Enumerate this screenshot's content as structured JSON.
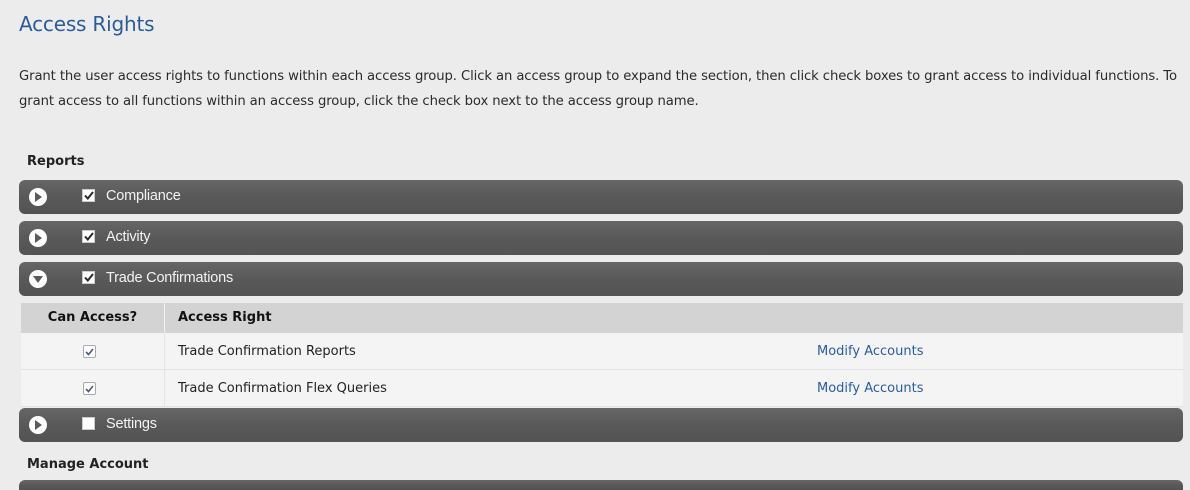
{
  "title": "Access Rights",
  "description": "Grant the user access rights to functions within each access group. Click an access group to expand the section, then click check boxes to grant access to individual functions. To grant access to all functions within an access group, click the check box next to the access group name.",
  "sections": {
    "reports_label": "Reports",
    "manage_account_label": "Manage Account"
  },
  "groups": [
    {
      "label": "Compliance",
      "checked": true,
      "expanded": false
    },
    {
      "label": "Activity",
      "checked": true,
      "expanded": false
    },
    {
      "label": "Trade Confirmations",
      "checked": true,
      "expanded": true
    },
    {
      "label": "Settings",
      "checked": false,
      "expanded": false
    }
  ],
  "table": {
    "col_can_access": "Can Access?",
    "col_access_right": "Access Right",
    "rows": [
      {
        "right": "Trade Confirmation Reports",
        "checked": true,
        "link": "Modify Accounts"
      },
      {
        "right": "Trade Confirmation Flex Queries",
        "checked": true,
        "link": "Modify Accounts"
      }
    ]
  },
  "colors": {
    "title": "#2a5c9a",
    "group_bar": "#595959",
    "link": "#2a5ca3",
    "background": "#ececec"
  },
  "icons": {
    "collapsed": "expand-arrow-icon",
    "expanded": "collapse-arrow-icon",
    "checked": "checkmark-icon"
  }
}
